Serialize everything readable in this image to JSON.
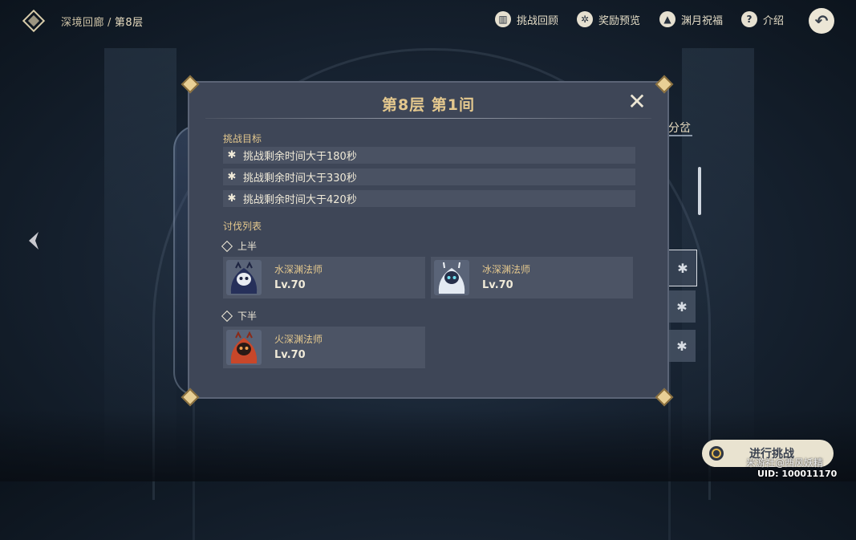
{
  "breadcrumb": {
    "root": "深境回廊",
    "separator": "/",
    "current": "第8层"
  },
  "topnav": [
    {
      "label": "挑战回顾",
      "icon": "book-icon"
    },
    {
      "label": "奖励预览",
      "icon": "gear-star-icon"
    },
    {
      "label": "渊月祝福",
      "icon": "up-arrow-icon"
    },
    {
      "label": "介绍",
      "icon": "question-icon"
    }
  ],
  "right_panel": {
    "tab_label": "分岔"
  },
  "dialog": {
    "title": "第8层 第1间",
    "goals_heading": "挑战目标",
    "goals": [
      "挑战剩余时间大于180秒",
      "挑战剩余时间大于330秒",
      "挑战剩余时间大于420秒"
    ],
    "enemies_heading": "讨伐列表",
    "first_half": {
      "label": "上半",
      "enemies": [
        {
          "name": "水深渊法师",
          "level": "Lv.70",
          "color": "#2d3a64"
        },
        {
          "name": "冰深渊法师",
          "level": "Lv.70",
          "color": "#dfe6ee"
        }
      ]
    },
    "second_half": {
      "label": "下半",
      "enemies": [
        {
          "name": "火深渊法师",
          "level": "Lv.70",
          "color": "#c8472a"
        }
      ]
    }
  },
  "start_button": {
    "label": "进行挑战"
  },
  "watermark": "米游社@西风妖精",
  "uid": "UID: 100011170"
}
